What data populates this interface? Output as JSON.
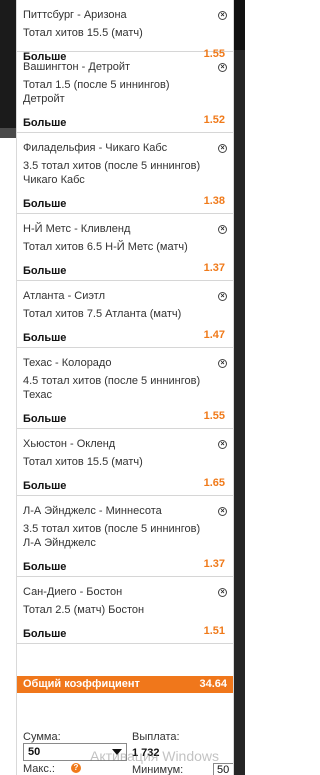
{
  "bets": [
    {
      "match": "Питтсбург - Аризона",
      "market": "Тотал хитов 15.5 (матч)",
      "selection": "Больше",
      "odds": "1.55"
    },
    {
      "match": "Вашингтон - Детройт",
      "market": "Тотал 1.5 (после 5 иннингов) Детройт",
      "selection": "Больше",
      "odds": "1.52"
    },
    {
      "match": "Филадельфия - Чикаго Кабс",
      "market": "3.5 тотал хитов (после 5 иннингов) Чикаго Кабс",
      "selection": "Больше",
      "odds": "1.38"
    },
    {
      "match": "Н-Й Метс - Кливленд",
      "market": "Тотал хитов 6.5 Н-Й Метс (матч)",
      "selection": "Больше",
      "odds": "1.37"
    },
    {
      "match": "Атланта - Сиэтл",
      "market": "Тотал хитов 7.5 Атланта (матч)",
      "selection": "Больше",
      "odds": "1.47"
    },
    {
      "match": "Техас - Колорадо",
      "market": "4.5 тотал хитов (после 5 иннингов) Техас",
      "selection": "Больше",
      "odds": "1.55"
    },
    {
      "match": "Хьюстон - Окленд",
      "market": "Тотал хитов 15.5 (матч)",
      "selection": "Больше",
      "odds": "1.65"
    },
    {
      "match": "Л-А Эйнджелс - Миннесота",
      "market": "3.5 тотал хитов (после 5 иннингов) Л-А Эйнджелс",
      "selection": "Больше",
      "odds": "1.37"
    },
    {
      "match": "Сан-Диего - Бостон",
      "market": "Тотал 2.5 (матч) Бостон",
      "selection": "Больше",
      "odds": "1.51"
    }
  ],
  "close_icon": "close-circle-icon",
  "total": {
    "label": "Общий коэффициент",
    "value": "34.64"
  },
  "stake": {
    "sum_label": "Сумма:",
    "sum_value": "50",
    "payout_label": "Выплата:",
    "payout_value": "1 732",
    "max_label": "Макс.:",
    "min_label": "Минимум:",
    "min_value": "50"
  },
  "watermark": "Активация Windows",
  "colors": {
    "accent": "#f07a1a",
    "text": "#333333"
  }
}
